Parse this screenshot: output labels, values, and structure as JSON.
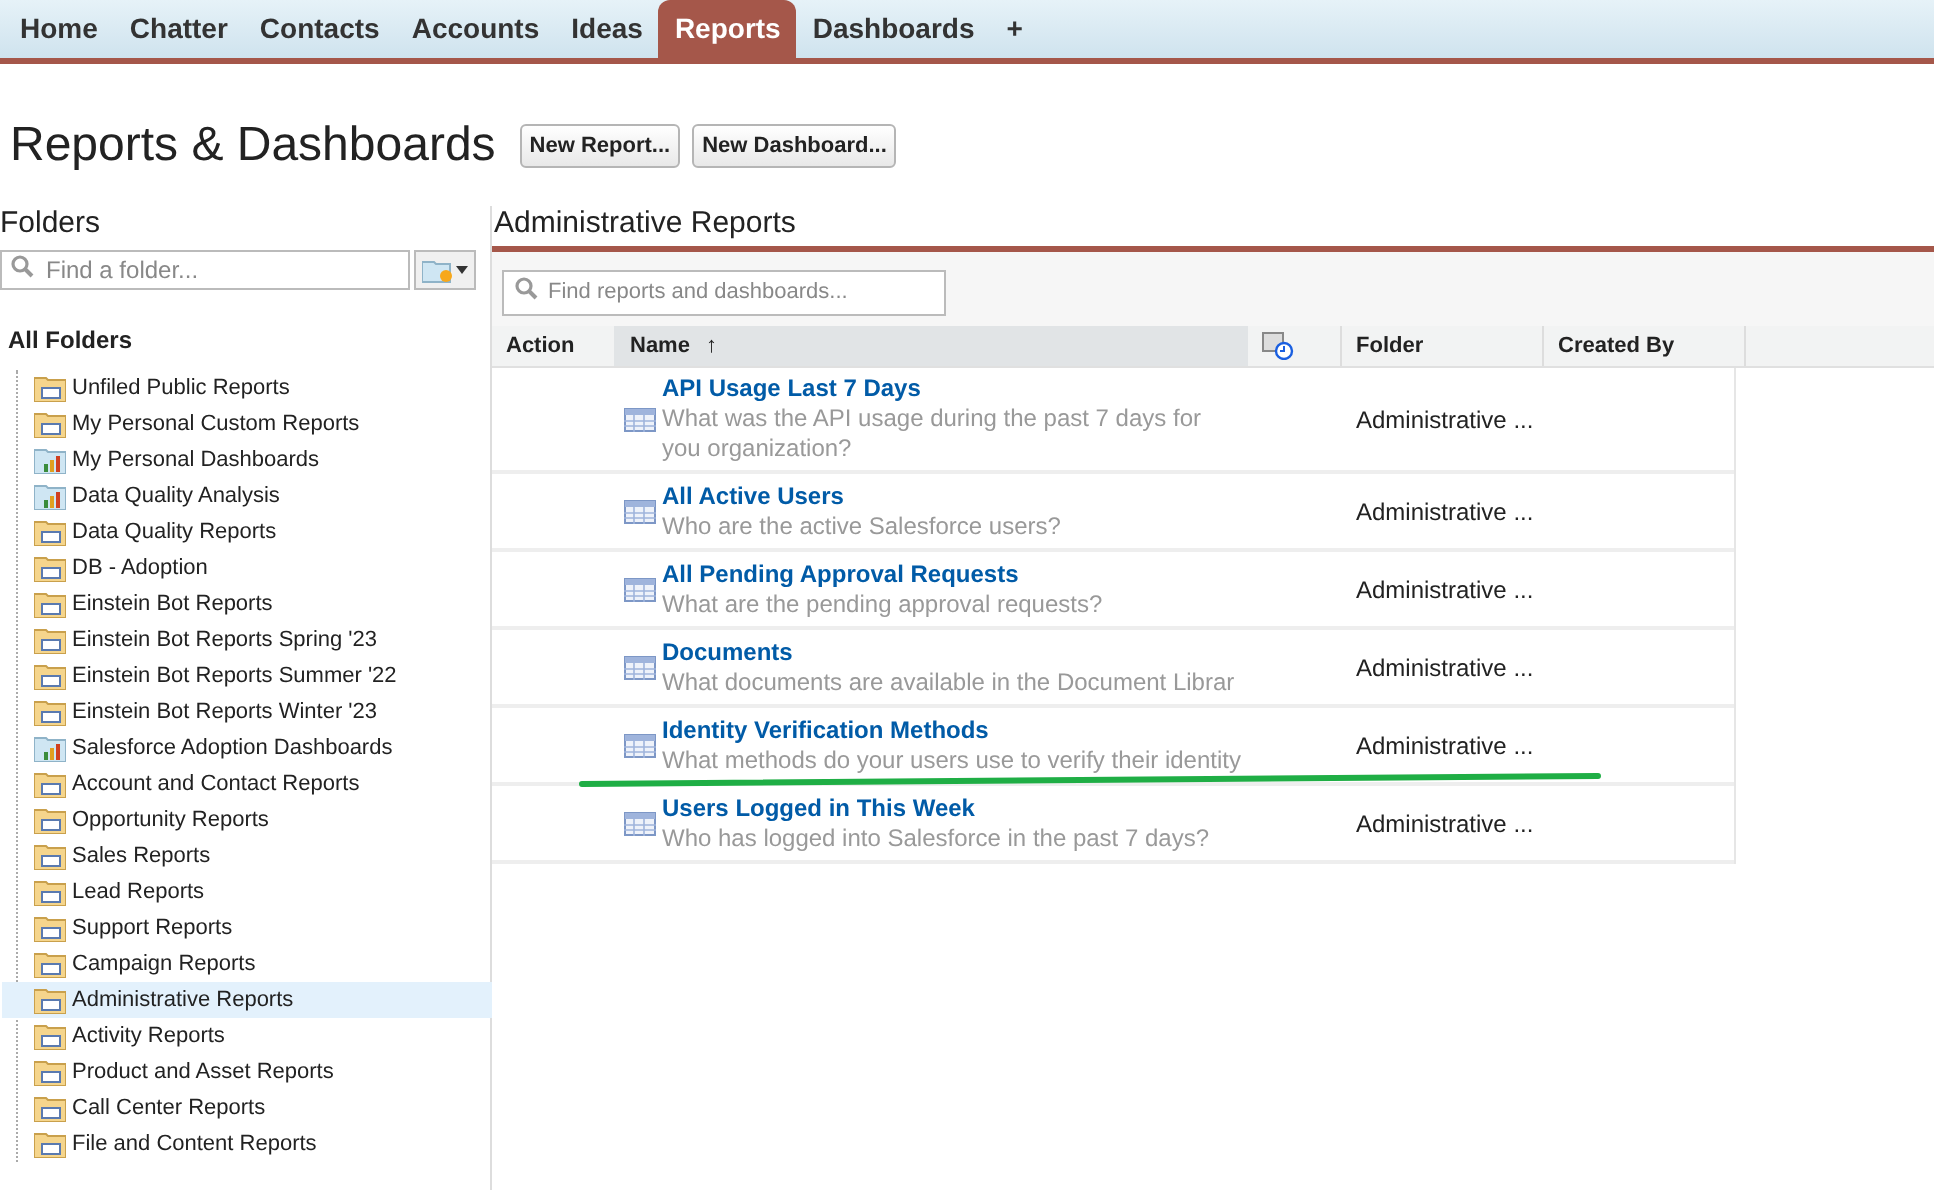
{
  "nav_tabs": [
    {
      "label": "Home",
      "selected": false
    },
    {
      "label": "Chatter",
      "selected": false
    },
    {
      "label": "Contacts",
      "selected": false
    },
    {
      "label": "Accounts",
      "selected": false
    },
    {
      "label": "Ideas",
      "selected": false
    },
    {
      "label": "Reports",
      "selected": true
    },
    {
      "label": "Dashboards",
      "selected": false
    },
    {
      "label": "+",
      "selected": false
    }
  ],
  "page_title": "Reports & Dashboards",
  "header_buttons": [
    "New Report...",
    "New Dashboard..."
  ],
  "folders": {
    "title": "Folders",
    "search": {
      "placeholder": "Find a folder..."
    },
    "root": "All Folders",
    "items": [
      {
        "label": "Unfiled Public Reports",
        "kind": "report",
        "selected": false
      },
      {
        "label": "My Personal Custom Reports",
        "kind": "report",
        "selected": false
      },
      {
        "label": "My Personal Dashboards",
        "kind": "dashboard",
        "selected": false
      },
      {
        "label": "Data Quality Analysis",
        "kind": "dashboard",
        "selected": false
      },
      {
        "label": "Data Quality Reports",
        "kind": "report",
        "selected": false
      },
      {
        "label": "DB - Adoption",
        "kind": "report",
        "selected": false
      },
      {
        "label": "Einstein Bot Reports",
        "kind": "report",
        "selected": false
      },
      {
        "label": "Einstein Bot Reports Spring '23",
        "kind": "report",
        "selected": false
      },
      {
        "label": "Einstein Bot Reports Summer '22",
        "kind": "report",
        "selected": false
      },
      {
        "label": "Einstein Bot Reports Winter '23",
        "kind": "report",
        "selected": false
      },
      {
        "label": "Salesforce Adoption Dashboards",
        "kind": "dashboard",
        "selected": false
      },
      {
        "label": "Account and Contact Reports",
        "kind": "report",
        "selected": false
      },
      {
        "label": "Opportunity Reports",
        "kind": "report",
        "selected": false
      },
      {
        "label": "Sales Reports",
        "kind": "report",
        "selected": false
      },
      {
        "label": "Lead Reports",
        "kind": "report",
        "selected": false
      },
      {
        "label": "Support Reports",
        "kind": "report",
        "selected": false
      },
      {
        "label": "Campaign Reports",
        "kind": "report",
        "selected": false
      },
      {
        "label": "Administrative Reports",
        "kind": "report",
        "selected": true
      },
      {
        "label": "Activity Reports",
        "kind": "report",
        "selected": false
      },
      {
        "label": "Product and Asset Reports",
        "kind": "report",
        "selected": false
      },
      {
        "label": "Call Center Reports",
        "kind": "report",
        "selected": false
      },
      {
        "label": "File and Content Reports",
        "kind": "report",
        "selected": false
      }
    ]
  },
  "content": {
    "title": "Administrative Reports",
    "search": {
      "placeholder": "Find reports and dashboards..."
    },
    "table": {
      "columns": [
        "Action",
        "Name",
        "Folder",
        "Created By"
      ],
      "sort_arrow": "↑",
      "rows": [
        {
          "name": "API Usage Last 7 Days",
          "description": "What was the API usage during the past 7 days for you organization?",
          "folder": "Administrative ..."
        },
        {
          "name": "All Active Users",
          "description": "Who are the active Salesforce users?",
          "folder": "Administrative ..."
        },
        {
          "name": "All Pending Approval Requests",
          "description": "What are the pending approval requests?",
          "folder": "Administrative ..."
        },
        {
          "name": "Documents",
          "description": "What documents are available in the Document Librar",
          "folder": "Administrative ..."
        },
        {
          "name": "Identity Verification Methods",
          "description": "What methods do your users use to verify their identity",
          "folder": "Administrative ..."
        },
        {
          "name": "Users Logged in This Week",
          "description": "Who has logged into Salesforce in the past 7 days?",
          "folder": "Administrative ..."
        }
      ]
    }
  }
}
